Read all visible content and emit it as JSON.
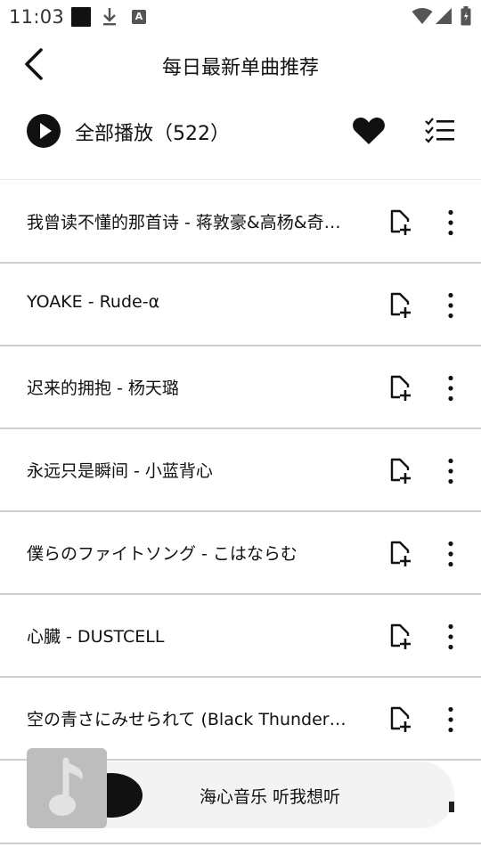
{
  "status_bar": {
    "time": "11:03",
    "notification_icons": [
      "black-square-icon",
      "download-icon",
      "a-badge-icon"
    ],
    "a_badge": "A",
    "system_icons": [
      "wifi-icon",
      "signal-icon",
      "battery-icon"
    ]
  },
  "header": {
    "title": "每日最新单曲推荐",
    "back_icon": "chevron-left-icon"
  },
  "play_all": {
    "label": "全部播放（522）",
    "actions": [
      "heart-icon",
      "checklist-icon"
    ]
  },
  "songs": [
    {
      "title": "我曾读不懂的那首诗 - 蒋敦豪&高杨&奇…"
    },
    {
      "title": "YOAKE - Rude-α"
    },
    {
      "title": "迟来的拥抱 - 杨天璐"
    },
    {
      "title": "永远只是瞬间 - 小蓝背心"
    },
    {
      "title": "僕らのファイトソング - こはならむ"
    },
    {
      "title": "心臓 - DUSTCELL"
    },
    {
      "title": "空の青さにみせられて (Black Thunderbi…"
    }
  ],
  "row_icons": [
    "add-to-playlist-icon",
    "more-vertical-icon"
  ],
  "mini_player": {
    "text": "海心音乐 听我想听",
    "cover_icon": "music-note-icon"
  },
  "colors": {
    "background": "#ffffff",
    "text": "#111111",
    "divider": "#cfcfcf",
    "player_bg": "#f3f3f3",
    "cover_bg": "#bdbdbd"
  }
}
